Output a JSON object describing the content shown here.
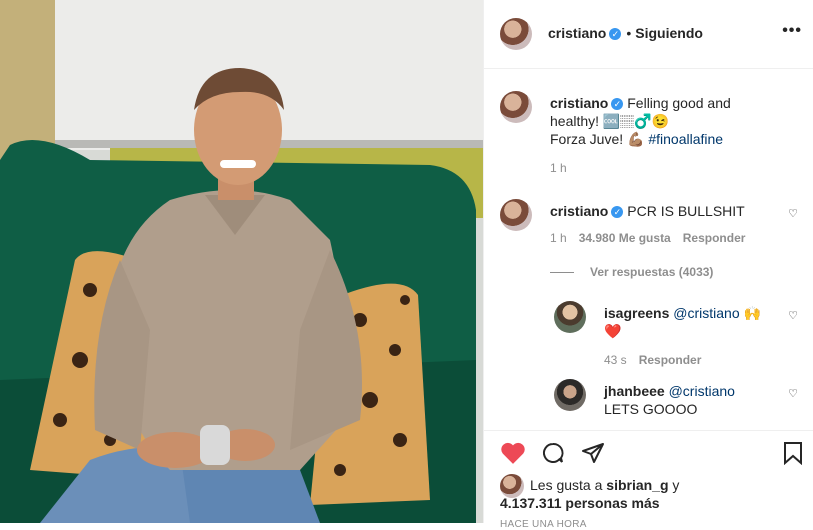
{
  "post": {
    "username": "cristiano",
    "verified_mark": "✓",
    "separator": "•",
    "follow_status": "Siguiendo",
    "more_icon": "•••"
  },
  "caption": {
    "username": "cristiano",
    "text_line1": "Felling good and healthy! 🆒🏽♂️😉",
    "text_line2": "Forza Juve! 💪🏽",
    "hashtag": "#finoallafine",
    "time": "1 h"
  },
  "comments": [
    {
      "username": "cristiano",
      "text": "PCR IS BULLSHIT",
      "time": "1 h",
      "likes": "34.980 Me gusta",
      "reply": "Responder",
      "view_replies": "Ver respuestas (4033)"
    },
    {
      "username": "isagreens",
      "mention": "@cristiano",
      "text": "🙌 ❤️",
      "time": "43 s",
      "reply": "Responder"
    },
    {
      "username": "jhanbeee",
      "mention": "@cristiano",
      "text": "LETS GOOOO"
    }
  ],
  "likes": {
    "prefix": "Les gusta a",
    "user": "sibrian_g",
    "joiner": "y",
    "others": "4.137.311 personas más"
  },
  "timestamp": "HACE UNA HORA",
  "colors": {
    "link": "#00376b",
    "verified": "#3897f0",
    "like_red": "#ed4956",
    "muted": "#8e8e8e"
  }
}
